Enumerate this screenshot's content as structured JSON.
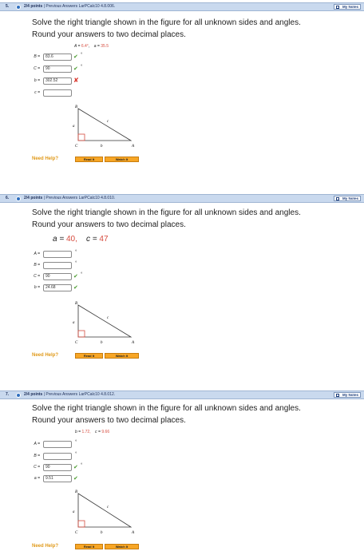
{
  "problems": [
    {
      "number": "5.",
      "points": "2/4 points",
      "previous_answers": "Previous Answers",
      "problem_id": "LarPCalc10 4.8.006.",
      "my_notes": "My Notes",
      "question": [
        "Solve the right triangle shown in the figure for all unknown sides and angles.",
        "Round your answers to two decimal places."
      ],
      "given": [
        {
          "label": "A = ",
          "value": "6.4°"
        },
        {
          "label": "a = ",
          "value": "35.5"
        }
      ],
      "answers": [
        {
          "label": "B =",
          "value": "83.6",
          "unit": "°",
          "status": "correct"
        },
        {
          "label": "C =",
          "value": "90",
          "unit": "°",
          "status": "correct"
        },
        {
          "label": "b =",
          "value": "302.52",
          "unit": "",
          "status": "incorrect"
        },
        {
          "label": "c =",
          "value": "",
          "unit": "",
          "status": "none"
        }
      ],
      "figure_labels": {
        "B": "B",
        "C": "C",
        "A": "A",
        "a": "a",
        "b": "b",
        "c": "c"
      },
      "need_help": "Need Help?",
      "read_it": "Read It",
      "watch_it": "Watch It"
    },
    {
      "number": "6.",
      "points": "2/4 points",
      "previous_answers": "Previous Answers",
      "problem_id": "LarPCalc10 4.8.010.",
      "my_notes": "My Notes",
      "question": [
        "Solve the right triangle shown in the figure for all unknown sides and angles.",
        "Round your answers to two decimal places."
      ],
      "given": [
        {
          "label": "a = ",
          "value": "40,"
        },
        {
          "label": "c = ",
          "value": "47"
        }
      ],
      "answers": [
        {
          "label": "A =",
          "value": "",
          "unit": "°",
          "status": "none"
        },
        {
          "label": "B =",
          "value": "",
          "unit": "°",
          "status": "none"
        },
        {
          "label": "C =",
          "value": "90",
          "unit": "°",
          "status": "correct"
        },
        {
          "label": "b =",
          "value": "24.68",
          "unit": "",
          "status": "correct"
        }
      ],
      "figure_labels": {
        "B": "B",
        "C": "C",
        "A": "A",
        "a": "a",
        "b": "b",
        "c": "c"
      },
      "need_help": "Need Help?",
      "read_it": "Read It",
      "watch_it": "Watch It"
    },
    {
      "number": "7.",
      "points": "2/4 points",
      "previous_answers": "Previous Answers",
      "problem_id": "LarPCalc10 4.8.012.",
      "my_notes": "My Notes",
      "question": [
        "Solve the right triangle shown in the figure for all unknown sides and angles.",
        "Round your answers to two decimal places."
      ],
      "given": [
        {
          "label": "b = ",
          "value": "1.72,"
        },
        {
          "label": "c = ",
          "value": "9.66"
        }
      ],
      "answers": [
        {
          "label": "A =",
          "value": "",
          "unit": "°",
          "status": "none"
        },
        {
          "label": "B =",
          "value": "",
          "unit": "°",
          "status": "none"
        },
        {
          "label": "C =",
          "value": "90",
          "unit": "°",
          "status": "correct"
        },
        {
          "label": "a =",
          "value": "9.51",
          "unit": "",
          "status": "correct"
        }
      ],
      "figure_labels": {
        "B": "B",
        "C": "C",
        "A": "A",
        "a": "a",
        "b": "b",
        "c": "c"
      },
      "need_help": "Need Help?",
      "read_it": "Read It",
      "watch_it": "Watch It"
    }
  ],
  "colors": {
    "header_bg": "#c9d9ee",
    "given_value": "#d64b3e",
    "check": "#4a9b2e",
    "cross": "#d9352b",
    "help": "#e09a1b",
    "button": "#f7a626"
  }
}
